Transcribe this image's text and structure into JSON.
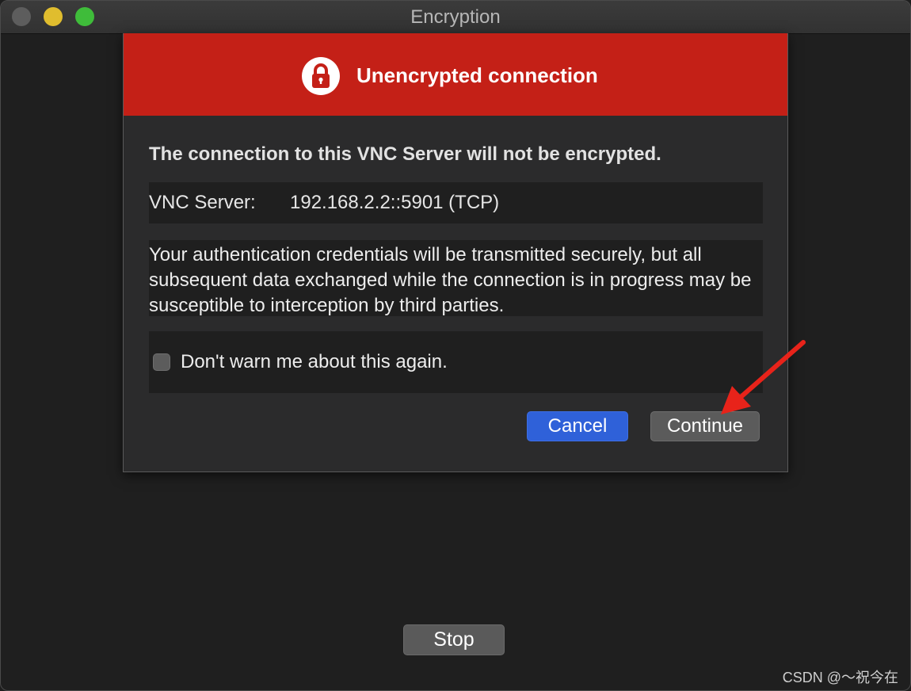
{
  "window": {
    "title": "Encryption"
  },
  "dialog": {
    "banner_title": "Unencrypted connection",
    "banner_icon": "lock-icon",
    "banner_color": "#c42017",
    "heading": "The connection to this VNC Server will not be encrypted.",
    "server_label": "VNC Server:",
    "server_value": "192.168.2.2::5901 (TCP)",
    "description": "Your authentication credentials will be transmitted securely, but all subsequent data exchanged while the connection is in progress may be susceptible to interception by third parties.",
    "checkbox_label": "Don't warn me about this again.",
    "checkbox_checked": false,
    "cancel_label": "Cancel",
    "continue_label": "Continue"
  },
  "footer": {
    "stop_label": "Stop"
  },
  "watermark": "CSDN @～祝今在",
  "annotation": {
    "icon": "red-arrow-icon",
    "color": "#e8231a"
  }
}
